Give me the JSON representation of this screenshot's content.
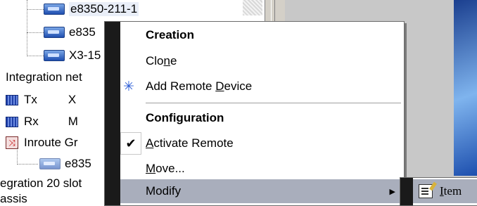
{
  "tree": {
    "remotes": [
      {
        "label": "e8350-211-1",
        "selected": true
      },
      {
        "label": "e835"
      },
      {
        "label": "X3-15"
      }
    ],
    "integration_net_label": "Integration net",
    "carriers": [
      {
        "label": "Tx",
        "extra": "X",
        "icon": "carrier-bars-icon"
      },
      {
        "label": "Rx",
        "extra": "M",
        "icon": "carrier-bars-icon"
      }
    ],
    "inroute_group_label": "Inroute Gr",
    "inroute_remote_label": "e835",
    "chassis_line1": "egration 20 slot",
    "chassis_line2": "assis"
  },
  "context_menu": {
    "creation_header": "Creation",
    "clone": {
      "before": "Clo",
      "accel": "n",
      "after": "e"
    },
    "add_remote_device": {
      "before": "Add Remote ",
      "accel": "D",
      "after": "evice",
      "icon": "sparkle-icon"
    },
    "configuration_header": "Configuration",
    "activate_remote": {
      "before": "",
      "accel": "A",
      "after": "ctivate Remote",
      "checked": true
    },
    "move": {
      "before": "",
      "accel": "M",
      "after": "ove..."
    },
    "modify": {
      "label": "Modify",
      "has_submenu": true
    }
  },
  "submenu": {
    "item": {
      "before": "",
      "accel": "I",
      "after": "tem",
      "icon": "edit-item-icon"
    }
  },
  "colors": {
    "menu_highlight": "#a9aebc",
    "menu_gutter": "#1a1a1a",
    "node_icon": "#1f4fb0"
  }
}
